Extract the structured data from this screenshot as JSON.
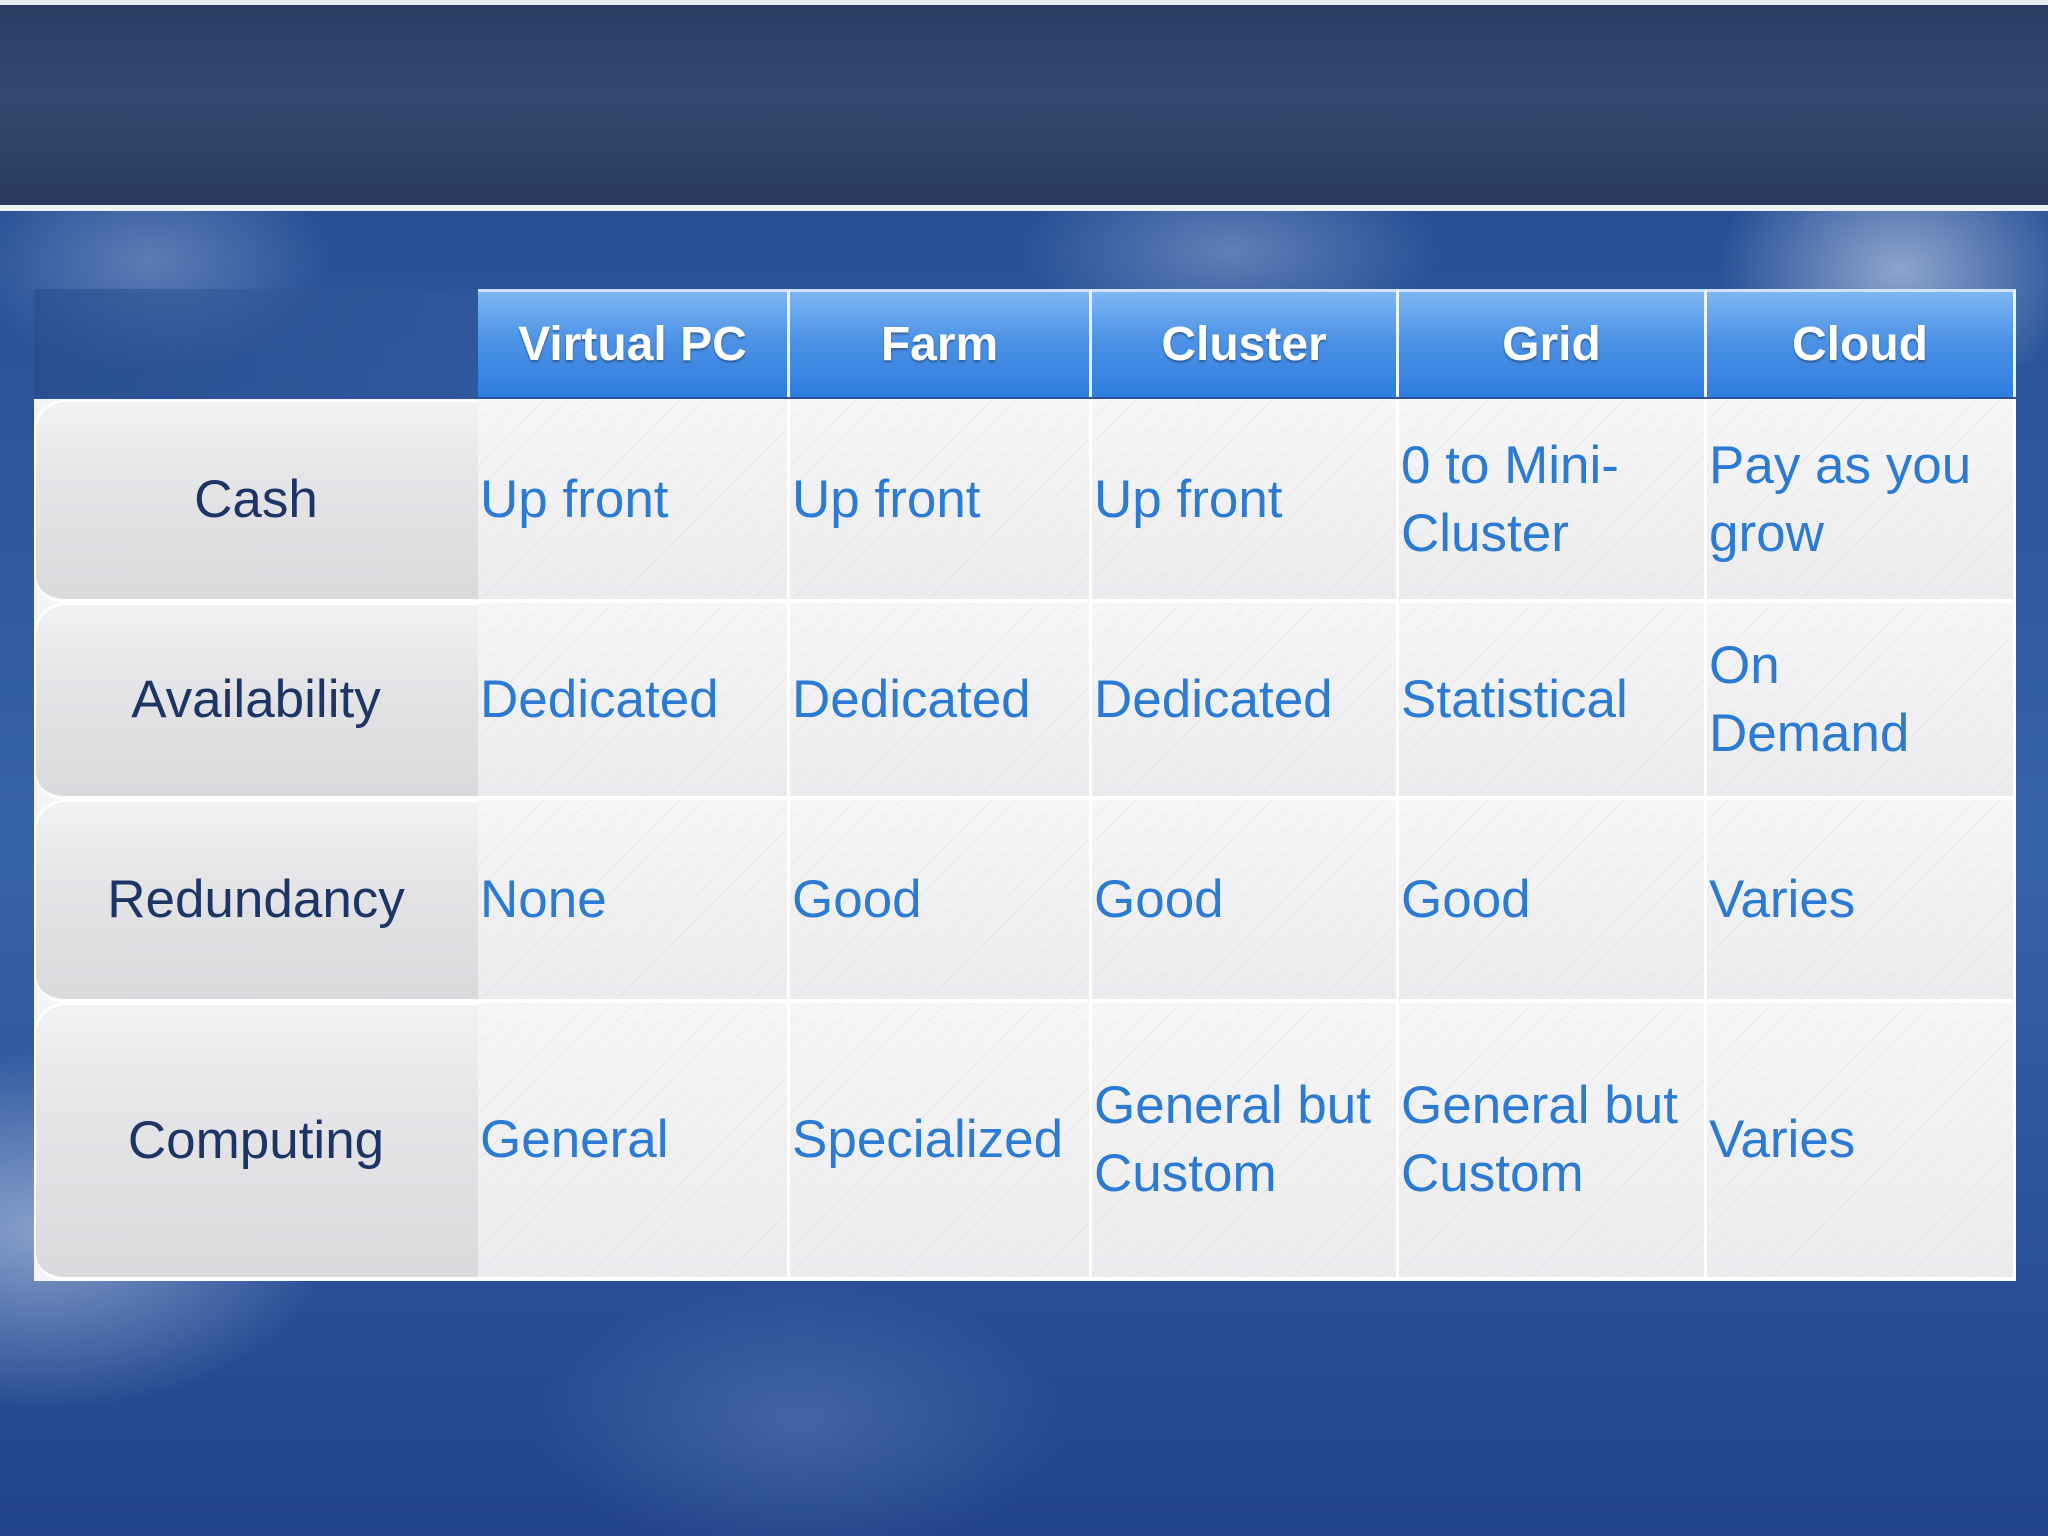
{
  "table": {
    "columns": [
      "Virtual PC",
      "Farm",
      "Cluster",
      "Grid",
      "Cloud"
    ],
    "rows": [
      {
        "label": "Cash",
        "cells": [
          "Up front",
          "Up front",
          "Up front",
          "0 to Mini-\nCluster",
          "Pay as you\ngrow"
        ]
      },
      {
        "label": "Availability",
        "cells": [
          "Dedicated",
          "Dedicated",
          "Dedicated",
          "Statistical",
          "On\nDemand"
        ]
      },
      {
        "label": "Redundancy",
        "cells": [
          "None",
          "Good",
          "Good",
          "Good",
          "Varies"
        ]
      },
      {
        "label": "Computing",
        "cells": [
          "General",
          "Specialized",
          "General but\nCustom",
          "General but\nCustom",
          "Varies"
        ]
      }
    ]
  },
  "colors": {
    "header_blue": "#3a86e3",
    "cell_text": "#2b7ad3",
    "label_text": "#1d3566",
    "title_bar": "#2f4269"
  }
}
